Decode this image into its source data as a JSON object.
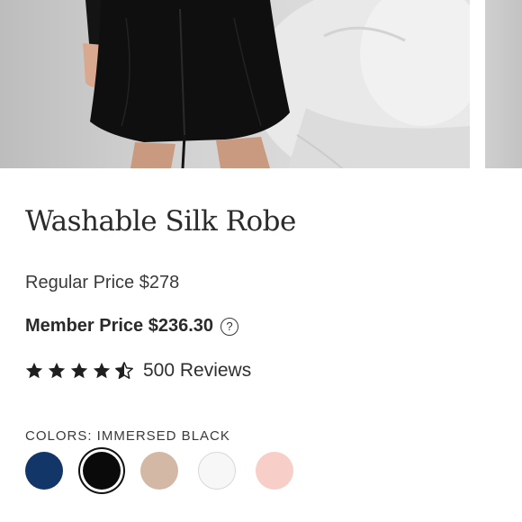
{
  "product": {
    "title": "Washable Silk Robe",
    "regular_price": "Regular Price $278",
    "member_price": "Member Price $236.30",
    "help_icon_glyph": "?",
    "rating_value": 4.5,
    "rating_max": 5,
    "reviews": "500 Reviews"
  },
  "colors": {
    "label": "COLORS: IMMERSED BLACK",
    "swatches": [
      {
        "color": "#123668",
        "selected": false
      },
      {
        "color": "#0a0a0a",
        "selected": true
      },
      {
        "color": "#d4b8a6",
        "selected": false
      },
      {
        "color": "#f7f7f7",
        "selected": false
      },
      {
        "color": "#f7cfc8",
        "selected": false
      }
    ]
  },
  "icons": {
    "help": "question-circle-icon",
    "star": "star-icon"
  }
}
